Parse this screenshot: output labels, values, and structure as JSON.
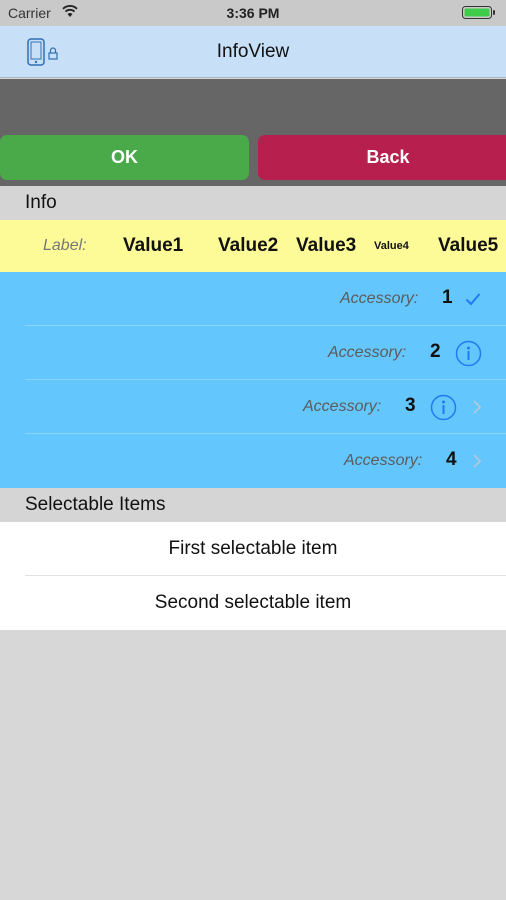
{
  "status_bar": {
    "carrier": "Carrier",
    "time": "3:36 PM"
  },
  "nav": {
    "title": "InfoView",
    "left_icon": "device-lock-icon",
    "background": "#c8e0f7"
  },
  "buttons": {
    "ok_label": "OK",
    "back_label": "Back",
    "ok_color": "#4aa949",
    "back_color": "#b7204e"
  },
  "sections": {
    "info_title": "Info",
    "selectable_title": "Selectable Items"
  },
  "label_row": {
    "label": "Label:",
    "values": [
      "Value1",
      "Value2",
      "Value3",
      "Value4",
      "Value5"
    ]
  },
  "accessory_rows": [
    {
      "label": "Accessory:",
      "number": "1",
      "accessories": [
        "checkmark-icon"
      ]
    },
    {
      "label": "Accessory:",
      "number": "2",
      "accessories": [
        "info-icon"
      ]
    },
    {
      "label": "Accessory:",
      "number": "3",
      "accessories": [
        "info-icon",
        "chevron-right-icon"
      ]
    },
    {
      "label": "Accessory:",
      "number": "4",
      "accessories": [
        "chevron-right-icon"
      ]
    }
  ],
  "selectable_items": [
    "First selectable item",
    "Second selectable item"
  ]
}
